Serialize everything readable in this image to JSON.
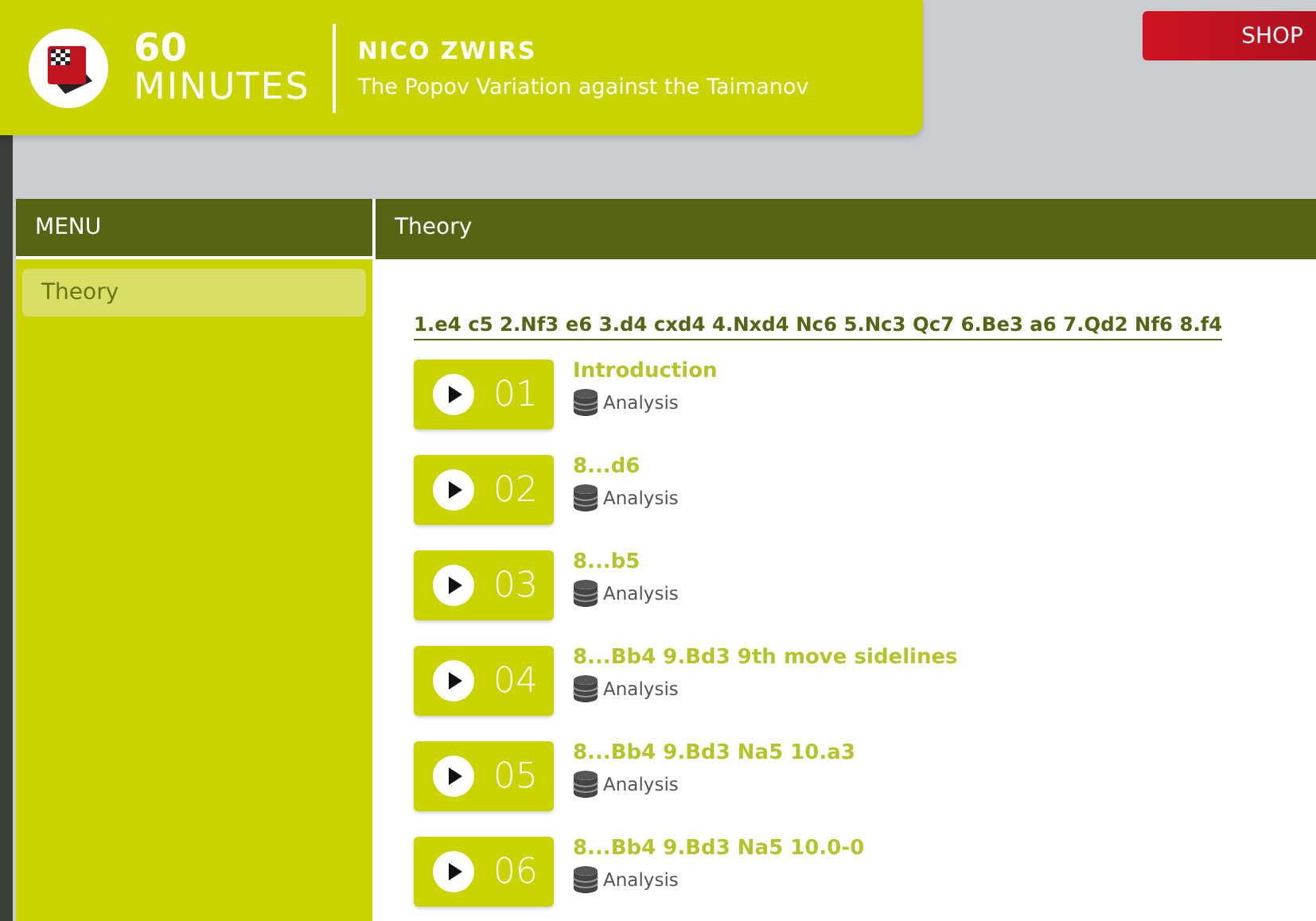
{
  "header": {
    "number": "60",
    "unit": "MINUTES",
    "author": "NICO ZWIRS",
    "title": "The Popov Variation against the Taimanov"
  },
  "shop_button": "SHOP",
  "menu": {
    "title": "MENU",
    "items": [
      {
        "label": "Theory",
        "selected": true
      }
    ]
  },
  "content": {
    "title": "Theory",
    "moves": "1.e4 c5 2.Nf3 e6 3.d4 cxd4 4.Nxd4 Nc6 5.Nc3 Qc7 6.Be3 a6 7.Qd2 Nf6 8.f4",
    "lessons": [
      {
        "number": "01",
        "title": "Introduction",
        "tag": "Analysis"
      },
      {
        "number": "02",
        "title": "8...d6",
        "tag": "Analysis"
      },
      {
        "number": "03",
        "title": "8...b5",
        "tag": "Analysis"
      },
      {
        "number": "04",
        "title": "8...Bb4 9.Bd3 9th move sidelines",
        "tag": "Analysis"
      },
      {
        "number": "05",
        "title": "8...Bb4 9.Bd3 Na5 10.a3",
        "tag": "Analysis"
      },
      {
        "number": "06",
        "title": "8...Bb4 9.Bd3 Na5 10.0-0",
        "tag": "Analysis"
      }
    ]
  }
}
